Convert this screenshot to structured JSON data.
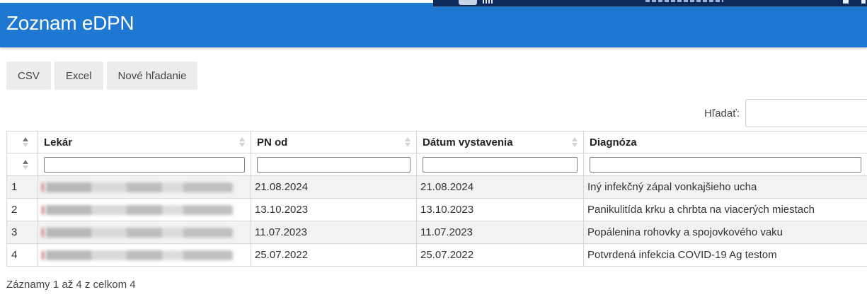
{
  "page": {
    "title": "Zoznam eDPN"
  },
  "toolbar": {
    "csv_label": "CSV",
    "excel_label": "Excel",
    "new_search_label": "Nové hľadanie"
  },
  "search": {
    "label": "Hľadať:",
    "value": ""
  },
  "table": {
    "headers": {
      "index": "",
      "doctor": "Lekár",
      "pn_from": "PN od",
      "issue_date": "Dátum vystavenia",
      "diagnosis": "Diagnóza"
    },
    "rows": [
      {
        "index": "1",
        "pn_from": "21.08.2024",
        "issue_date": "21.08.2024",
        "diagnosis": "Iný infekčný zápal vonkajšieho ucha"
      },
      {
        "index": "2",
        "pn_from": "13.10.2023",
        "issue_date": "13.10.2023",
        "diagnosis": "Panikulitída krku a chrbta na viacerých miestach"
      },
      {
        "index": "3",
        "pn_from": "11.07.2023",
        "issue_date": "11.07.2023",
        "diagnosis": "Popálenina rohovky a spojovkového vaku"
      },
      {
        "index": "4",
        "pn_from": "25.07.2022",
        "issue_date": "25.07.2022",
        "diagnosis": "Potvrdená infekcia COVID-19 Ag testom"
      }
    ]
  },
  "footer": {
    "info": "Záznamy 1 až 4 z celkom 4"
  },
  "colors": {
    "header_bg": "#1e78d2",
    "stripe": "#f2f2f2",
    "button_bg": "#ececec"
  }
}
